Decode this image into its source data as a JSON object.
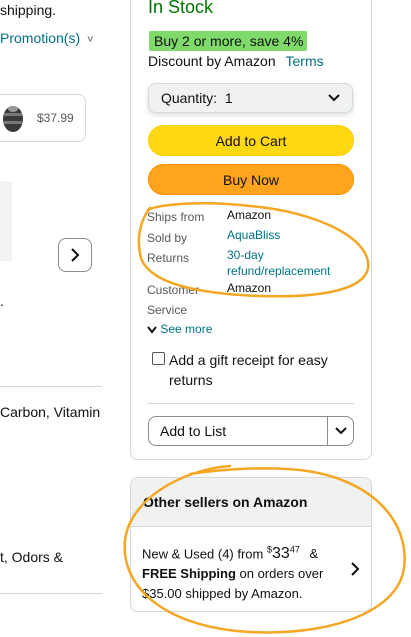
{
  "left": {
    "shipping_fragment": "shipping.",
    "promotion_link": "Promotion(s)",
    "thumb_price": "$37.99",
    "period_fragment": ".",
    "feature_fragment": "Carbon, Vitamin",
    "odors_fragment": "t, Odors &"
  },
  "buybox": {
    "stock_status": "In Stock",
    "promo_badge": "Buy 2 or more, save 4%",
    "discount_text": "Discount by Amazon",
    "terms_link": "Terms",
    "quantity_label": "Quantity:",
    "quantity_value": "1",
    "add_to_cart": "Add to Cart",
    "buy_now": "Buy Now",
    "info": {
      "ships_from_label": "Ships from",
      "ships_from_value": "Amazon",
      "sold_by_label": "Sold by",
      "sold_by_value": "AquaBliss",
      "returns_label": "Returns",
      "returns_value_line1": "30-day",
      "returns_value_line2": "refund/replacement",
      "customer_service_label_1": "Customer",
      "customer_service_label_2": "Service",
      "customer_service_value": "Amazon"
    },
    "see_more": "See more",
    "gift_receipt_line1": "Add a gift receipt for easy",
    "gift_receipt_line2": "returns",
    "add_to_list": "Add to List"
  },
  "other_sellers": {
    "title": "Other sellers on Amazon",
    "offer_prefix": "New & Used (4) from",
    "price_dollar": "$",
    "price_whole": "33",
    "price_fraction": "47",
    "offer_amp": "&",
    "free_shipping": "FREE Shipping",
    "offer_suffix_1": " on orders over",
    "offer_suffix_2": "$35.00 shipped by Amazon."
  },
  "colors": {
    "stock_green": "#007600",
    "link_teal": "#007185",
    "badge_green": "#7fda6b",
    "cart_yellow": "#ffd814",
    "buy_orange": "#ffa41c",
    "annotation_orange": "#f5a623"
  },
  "icons": [
    "chevron-down-icon",
    "chevron-right-icon",
    "checkbox-icon",
    "dropdown-arrow-icon"
  ]
}
